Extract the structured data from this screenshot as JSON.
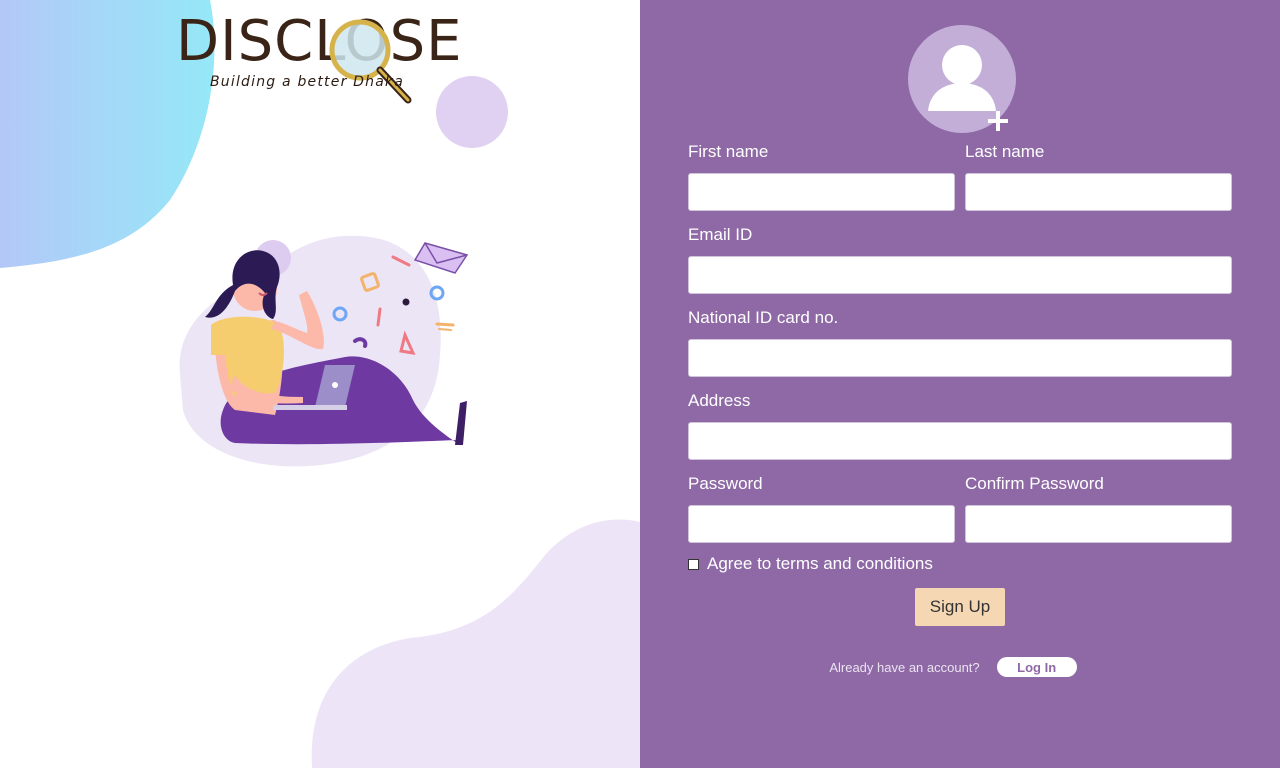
{
  "brand": {
    "name": "DISCLOSE",
    "tagline": "Building a better Dhaka"
  },
  "form": {
    "first_name_label": "First name",
    "last_name_label": "Last name",
    "email_label": "Email ID",
    "national_id_label": "National ID card no.",
    "address_label": "Address",
    "password_label": "Password",
    "confirm_password_label": "Confirm Password",
    "first_name_value": "",
    "last_name_value": "",
    "email_value": "",
    "national_id_value": "",
    "address_value": "",
    "password_value": "",
    "confirm_password_value": "",
    "terms_label": "Agree to terms and conditions",
    "terms_checked": false,
    "signup_label": "Sign Up"
  },
  "footer": {
    "account_prompt": "Already have an account?",
    "login_label": "Log In"
  },
  "icons": {
    "avatar": "add-user-icon",
    "logo_lens": "magnifier-icon",
    "illustration": "woman-with-laptop"
  },
  "colors": {
    "panel_bg": "#8e69a6",
    "signup_button_bg": "#f5d8b3",
    "login_button_text": "#8e69a6",
    "logo_text": "#3a2417",
    "logo_lens_ring": "#d4b24c",
    "blob_cyan": "#9ee6f7",
    "blob_lavender": "#e4d7f2"
  }
}
